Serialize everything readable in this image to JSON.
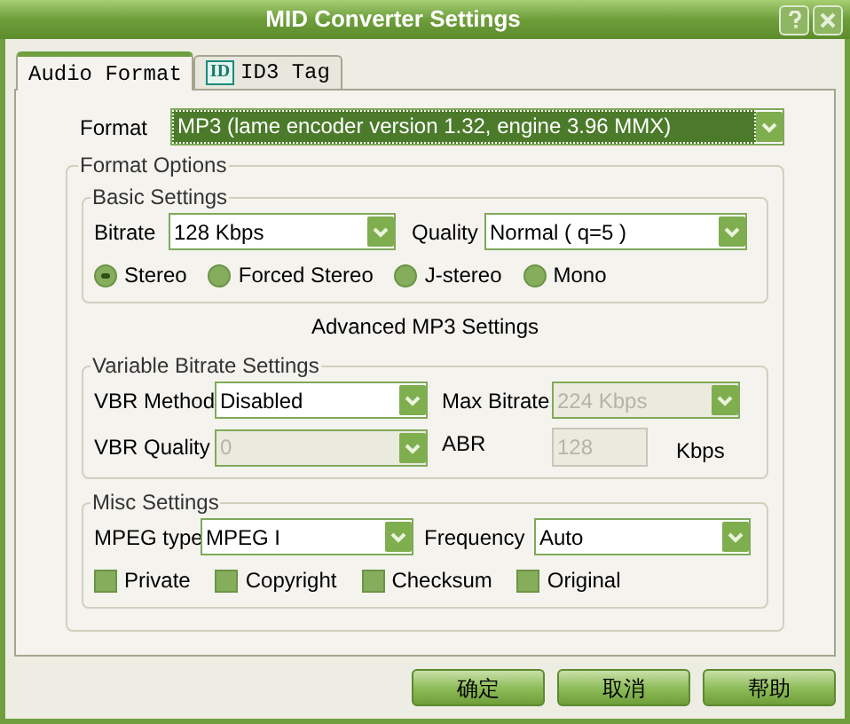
{
  "window": {
    "title": "MID Converter Settings"
  },
  "tabs": [
    {
      "label": "Audio Format",
      "selected": true
    },
    {
      "label": "ID3 Tag",
      "selected": false,
      "icon_text": "ID"
    }
  ],
  "format": {
    "label": "Format",
    "value": "MP3 (lame encoder version 1.32, engine 3.96 MMX)",
    "highlighted": true
  },
  "format_options": {
    "title": "Format Options",
    "basic_settings": {
      "title": "Basic Settings",
      "bitrate": {
        "label": "Bitrate",
        "value": "128 Kbps"
      },
      "quality": {
        "label": "Quality",
        "value": "Normal ( q=5 )"
      },
      "channel_modes": [
        {
          "label": "Stereo",
          "selected": true
        },
        {
          "label": "Forced Stereo",
          "selected": false
        },
        {
          "label": "J-stereo",
          "selected": false
        },
        {
          "label": "Mono",
          "selected": false
        }
      ]
    },
    "advanced_title": "Advanced MP3 Settings",
    "vbr_settings": {
      "title": "Variable Bitrate Settings",
      "method": {
        "label": "VBR Method",
        "value": "Disabled",
        "disabled": false
      },
      "max_bitrate": {
        "label": "Max Bitrate",
        "value": "224 Kbps",
        "disabled": true
      },
      "quality": {
        "label": "VBR Quality",
        "value": "0",
        "disabled": true
      },
      "abr": {
        "label": "ABR",
        "value": "128",
        "disabled": true,
        "unit": "Kbps"
      }
    },
    "misc_settings": {
      "title": "Misc Settings",
      "mpeg_type": {
        "label": "MPEG type",
        "value": "MPEG I"
      },
      "frequency": {
        "label": "Frequency",
        "value": "Auto"
      },
      "flags": [
        {
          "label": "Private",
          "checked": false
        },
        {
          "label": "Copyright",
          "checked": false
        },
        {
          "label": "Checksum",
          "checked": false
        },
        {
          "label": "Original",
          "checked": false
        }
      ]
    }
  },
  "buttons": [
    {
      "label": "确定"
    },
    {
      "label": "取消"
    },
    {
      "label": "帮助"
    }
  ]
}
